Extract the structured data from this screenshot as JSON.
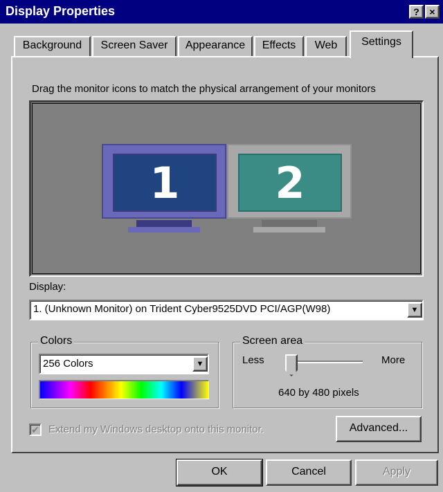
{
  "window": {
    "title": "Display Properties",
    "help_glyph": "?",
    "close_glyph": "×"
  },
  "tabs": [
    {
      "label": "Background"
    },
    {
      "label": "Screen Saver"
    },
    {
      "label": "Appearance"
    },
    {
      "label": "Effects"
    },
    {
      "label": "Web"
    },
    {
      "label": "Settings",
      "active": true
    }
  ],
  "settings": {
    "instruction": "Drag the monitor icons to match the physical arrangement of your monitors",
    "monitors": [
      {
        "number": "1",
        "selected": true,
        "color": "#1f4480"
      },
      {
        "number": "2",
        "selected": false,
        "color": "#3a8c84"
      }
    ],
    "display_label": "Display:",
    "display_value": "1. (Unknown Monitor) on Trident Cyber9525DVD PCI/AGP(W98)",
    "colors": {
      "group_title": "Colors",
      "value": "256 Colors"
    },
    "screen_area": {
      "group_title": "Screen area",
      "less_label": "Less",
      "more_label": "More",
      "resolution_text": "640 by 480 pixels",
      "slider_position": 0
    },
    "extend_desktop": {
      "label": "Extend my Windows desktop onto this monitor.",
      "checked": true,
      "disabled": true
    },
    "advanced_button": "Advanced..."
  },
  "buttons": {
    "ok": "OK",
    "cancel": "Cancel",
    "apply": "Apply"
  },
  "colors": {
    "title_bar": "#000080",
    "face": "#c0c0c0",
    "monitor_area": "#808080"
  }
}
